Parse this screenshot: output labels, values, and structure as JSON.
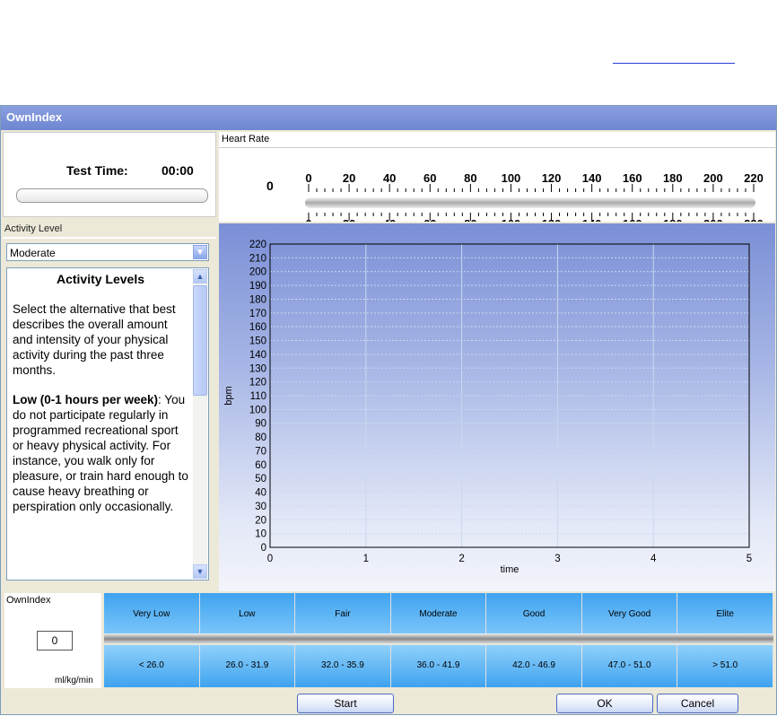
{
  "window": {
    "title": "OwnIndex"
  },
  "test": {
    "label": "Test Time:",
    "time": "00:00"
  },
  "heart_rate": {
    "section_label": "Heart Rate",
    "current_value": "0",
    "scale_ticks": [
      "0",
      "20",
      "40",
      "60",
      "80",
      "100",
      "120",
      "140",
      "160",
      "180",
      "200",
      "220"
    ]
  },
  "activity": {
    "section_label": "Activity Level",
    "selected": "Moderate",
    "heading": "Activity Levels",
    "intro": "Select the alternative that best describes the overall amount and intensity of your physical activity during the past three months.",
    "low_title": "Low (0-1 hours per week)",
    "low_text": ": You do not participate regularly in programmed recreational sport or heavy physical activity. For instance, you walk only for pleasure, or train hard enough to cause heavy breathing or perspiration only occasionally."
  },
  "chart_data": {
    "type": "line",
    "title": "",
    "xlabel": "time",
    "ylabel": "bpm",
    "xlim": [
      0,
      5
    ],
    "ylim": [
      0,
      220
    ],
    "x_ticks": [
      "0",
      "1",
      "2",
      "3",
      "4",
      "5"
    ],
    "y_ticks": [
      "0",
      "10",
      "20",
      "30",
      "40",
      "50",
      "60",
      "70",
      "80",
      "90",
      "100",
      "110",
      "120",
      "130",
      "140",
      "150",
      "160",
      "170",
      "180",
      "190",
      "200",
      "210",
      "220"
    ],
    "grid": true,
    "series": []
  },
  "ownindex": {
    "section_label": "OwnIndex",
    "value": "0",
    "unit": "ml/kg/min",
    "categories": [
      {
        "label": "Very Low",
        "range": "< 26.0"
      },
      {
        "label": "Low",
        "range": "26.0 - 31.9"
      },
      {
        "label": "Fair",
        "range": "32.0 - 35.9"
      },
      {
        "label": "Moderate",
        "range": "36.0 - 41.9"
      },
      {
        "label": "Good",
        "range": "42.0 - 46.9"
      },
      {
        "label": "Very Good",
        "range": "47.0 - 51.0"
      },
      {
        "label": "Elite",
        "range": "> 51.0"
      }
    ]
  },
  "buttons": {
    "start": "Start",
    "ok": "OK",
    "cancel": "Cancel"
  },
  "colors": {
    "title_bar": "#7b90d8",
    "category_blue": "#4eaaf2",
    "graph_top": "#7b8fd6"
  }
}
